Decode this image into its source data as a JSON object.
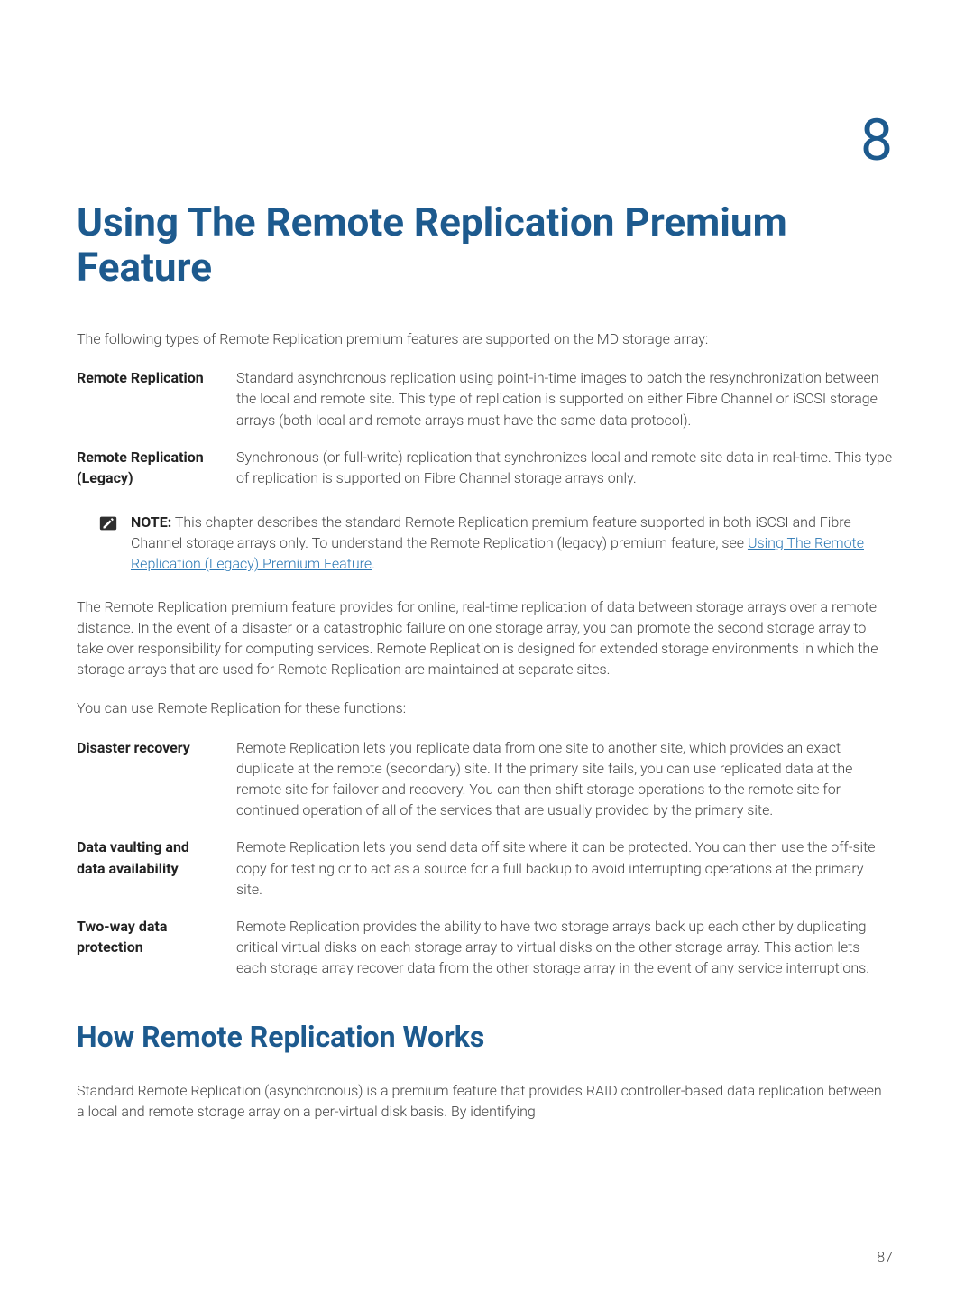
{
  "chapter_number": "8",
  "title": "Using The Remote Replication Premium Feature",
  "intro_text": "The following types of Remote Replication premium features are supported on the MD storage array:",
  "def_list_1": [
    {
      "term": "Remote Replication",
      "desc": "Standard asynchronous replication using point-in-time images to batch the resynchronization between the local and remote site. This type of replication is supported on either Fibre Channel or iSCSI storage arrays (both local and remote arrays must have the same data protocol)."
    },
    {
      "term": "Remote Replication (Legacy)",
      "desc": "Synchronous (or full-write) replication that synchronizes local and remote site data in real-time. This type of replication is supported on Fibre Channel storage arrays only."
    }
  ],
  "note": {
    "label": "NOTE:",
    "text_before_link": " This chapter describes the standard Remote Replication premium feature supported in both iSCSI and Fibre Channel storage arrays only. To understand the Remote Replication (legacy) premium feature, see ",
    "link_text": "Using The Remote Replication (Legacy) Premium Feature",
    "text_after_link": "."
  },
  "body_para_1": "The Remote Replication premium feature provides for online, real-time replication of data between storage arrays over a remote distance. In the event of a disaster or a catastrophic failure on one storage array, you can promote the second storage array to take over responsibility for computing services. Remote Replication is designed for extended storage environments in which the storage arrays that are used for Remote Replication are maintained at separate sites.",
  "body_para_2": "You can use Remote Replication for these functions:",
  "def_list_2": [
    {
      "term": "Disaster recovery",
      "desc": "Remote Replication lets you replicate data from one site to another site, which provides an exact duplicate at the remote (secondary) site. If the primary site fails, you can use replicated data at the remote site for failover and recovery. You can then shift storage operations to the remote site for continued operation of all of the services that are usually provided by the primary site."
    },
    {
      "term": "Data vaulting and data availability",
      "desc": "Remote Replication lets you send data off site where it can be protected. You can then use the off-site copy for testing or to act as a source for a full backup to avoid interrupting operations at the primary site."
    },
    {
      "term": "Two-way data protection",
      "desc": "Remote Replication provides the ability to have two storage arrays back up each other by duplicating critical virtual disks on each storage array to virtual disks on the other storage array. This action lets each storage array recover data from the other storage array in the event of any service interruptions."
    }
  ],
  "section_heading": "How Remote Replication Works",
  "body_para_3": "Standard Remote Replication (asynchronous) is a premium feature that provides RAID controller-based data replication between a local and remote storage array on a per-virtual disk basis. By identifying",
  "page_number": "87"
}
